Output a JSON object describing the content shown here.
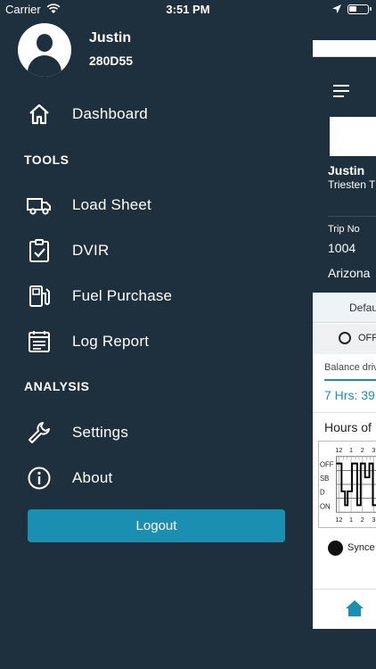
{
  "status_bar": {
    "carrier": "Carrier",
    "time": "3:51 PM"
  },
  "profile": {
    "name": "Justin",
    "code": "280D55"
  },
  "menu": {
    "dashboard": {
      "label": "Dashboard",
      "icon": "home-icon"
    },
    "tools_header": "TOOLS",
    "tools": [
      {
        "label": "Load Sheet",
        "icon": "truck-icon"
      },
      {
        "label": "DVIR",
        "icon": "clipboard-check-icon"
      },
      {
        "label": "Fuel Purchase",
        "icon": "fuel-pump-icon"
      },
      {
        "label": "Log Report",
        "icon": "report-icon"
      }
    ],
    "analysis_header": "ANALYSIS",
    "analysis": [
      {
        "label": "Settings",
        "icon": "wrench-icon"
      },
      {
        "label": "About",
        "icon": "info-icon"
      }
    ],
    "logout_label": "Logout"
  },
  "background_screen": {
    "driver_name": "Justin",
    "company": "Triesten T",
    "trip_label": "Trip No",
    "trip_no": "1004",
    "location": "Arizona",
    "tab_label": "Defau",
    "duty_status": "OFF",
    "balance_label": "Balance driv",
    "balance_value": "7 Hrs: 39",
    "hos_title": "Hours of",
    "log_rows": [
      "OFF",
      "SB",
      "D",
      "ON"
    ],
    "log_hours": [
      "12",
      "1",
      "2",
      "3"
    ],
    "synced_label": "Synce"
  },
  "colors": {
    "sidebar_bg": "#1e2f3d",
    "accent": "#1a8fb1",
    "text": "#ffffff"
  }
}
